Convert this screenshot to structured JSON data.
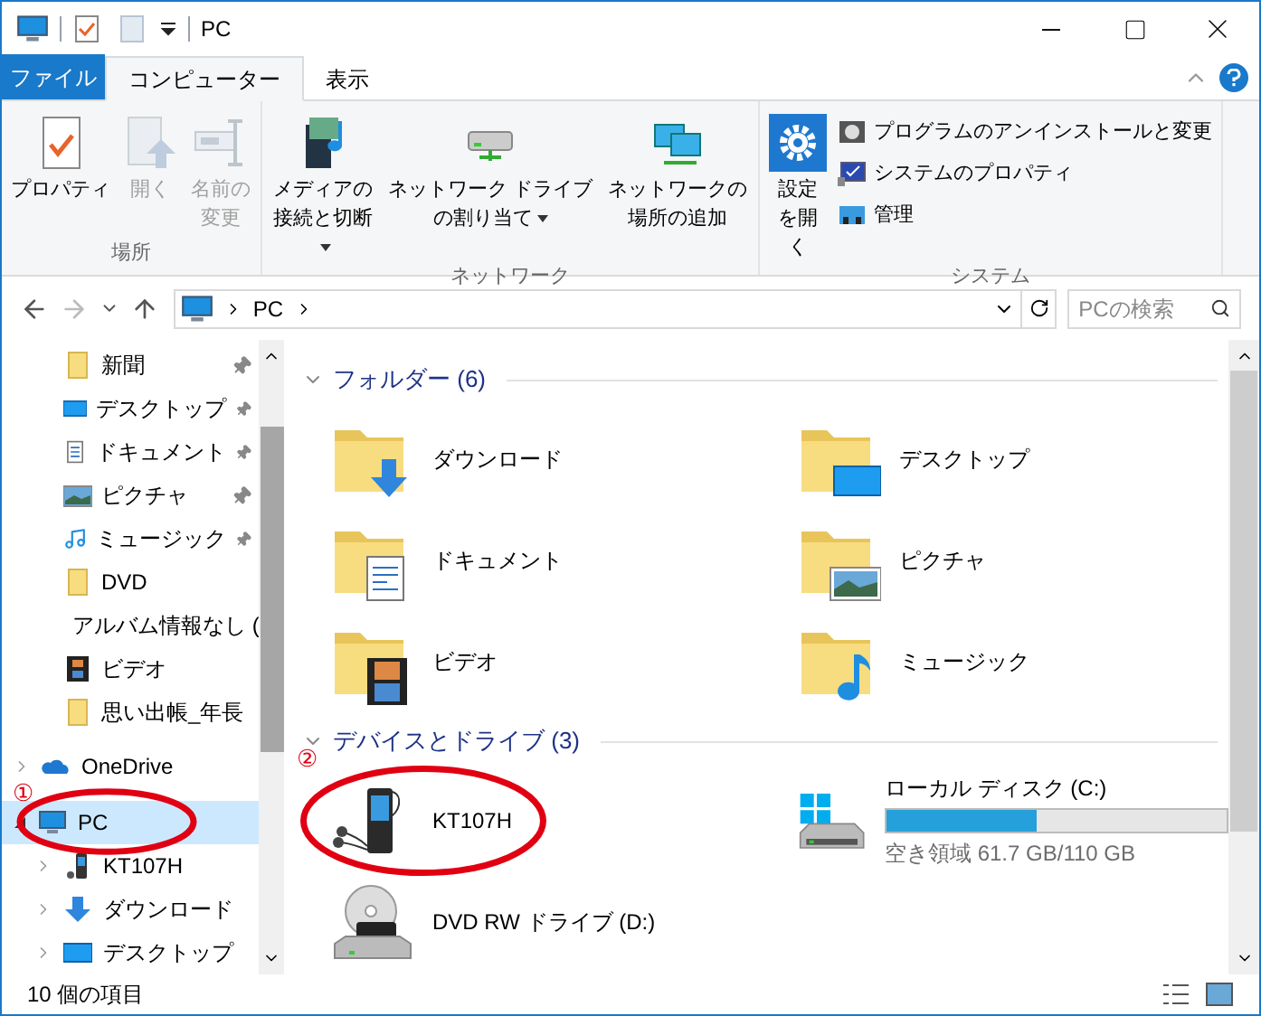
{
  "window": {
    "title": "PC"
  },
  "ribbon": {
    "tabs": [
      {
        "label": "ファイル",
        "kind": "file",
        "selected": false
      },
      {
        "label": "コンピューター",
        "kind": "tab",
        "selected": true
      },
      {
        "label": "表示",
        "kind": "tab",
        "selected": false
      }
    ],
    "groups": [
      {
        "label": "場所",
        "items": [
          {
            "kind": "properties",
            "label": "プロパティ",
            "disabled": false,
            "dropdown": false
          },
          {
            "kind": "open",
            "label": "開く",
            "disabled": true,
            "dropdown": false
          },
          {
            "kind": "rename",
            "label": "名前の変更",
            "disabled": true,
            "dropdown": false
          }
        ]
      },
      {
        "label": "ネットワーク",
        "items": [
          {
            "kind": "media",
            "label": "メディアの接続と切断",
            "disabled": false,
            "dropdown": true
          },
          {
            "kind": "map-drive",
            "label": "ネットワーク ドライブの割り当て",
            "disabled": false,
            "dropdown": true
          },
          {
            "kind": "add-location",
            "label": "ネットワークの場所の追加",
            "disabled": false,
            "dropdown": false
          }
        ]
      },
      {
        "label": "システム",
        "items": [
          {
            "kind": "settings",
            "label": "設定を開く",
            "disabled": false,
            "dropdown": false
          }
        ],
        "small_items": [
          {
            "kind": "uninstall",
            "label": "プログラムのアンインストールと変更"
          },
          {
            "kind": "system-properties",
            "label": "システムのプロパティ"
          },
          {
            "kind": "manage",
            "label": "管理"
          }
        ]
      }
    ]
  },
  "address_bar": {
    "path": [
      "PC"
    ],
    "search": {
      "placeholder": "PCの検索"
    }
  },
  "navigation_pane": {
    "quick_access": [
      {
        "kind": "folder",
        "label": "新聞",
        "pinned": true
      },
      {
        "kind": "desktop",
        "label": "デスクトップ",
        "pinned": true
      },
      {
        "kind": "document",
        "label": "ドキュメント",
        "pinned": true
      },
      {
        "kind": "picture",
        "label": "ピクチャ",
        "pinned": true
      },
      {
        "kind": "music",
        "label": "ミュージック",
        "pinned": true
      },
      {
        "kind": "folder",
        "label": "DVD",
        "pinned": false
      },
      {
        "kind": "folder",
        "label": "アルバム情報なし (",
        "pinned": false
      },
      {
        "kind": "video",
        "label": "ビデオ",
        "pinned": false
      },
      {
        "kind": "folder",
        "label": "思い出帳_年長",
        "pinned": false
      }
    ],
    "tree": [
      {
        "kind": "onedrive",
        "label": "OneDrive",
        "selected": false,
        "expanded": false
      },
      {
        "kind": "pc",
        "label": "PC",
        "selected": true,
        "expanded": true,
        "annotation": {
          "label": "①"
        },
        "children": [
          {
            "kind": "player",
            "label": "KT107H",
            "selected": false,
            "expanded": false
          },
          {
            "kind": "download",
            "label": "ダウンロード",
            "selected": false,
            "expanded": false
          },
          {
            "kind": "desktop",
            "label": "デスクトップ",
            "selected": false,
            "expanded": false
          }
        ]
      }
    ]
  },
  "content": {
    "sections": [
      {
        "title": "フォルダー (6)",
        "expanded": true,
        "items": [
          {
            "kind": "download",
            "label": "ダウンロード"
          },
          {
            "kind": "desktop",
            "label": "デスクトップ"
          },
          {
            "kind": "document",
            "label": "ドキュメント"
          },
          {
            "kind": "picture",
            "label": "ピクチャ"
          },
          {
            "kind": "video",
            "label": "ビデオ"
          },
          {
            "kind": "music",
            "label": "ミュージック"
          }
        ]
      },
      {
        "title": "デバイスとドライブ (3)",
        "expanded": true,
        "items": [
          {
            "kind": "player",
            "label": "KT107H",
            "annotation": {
              "label": "②"
            }
          },
          {
            "kind": "disk",
            "label": "ローカル ディスク (C:)",
            "level": 0.44,
            "info": "空き領域 61.7 GB/110 GB"
          },
          {
            "kind": "dvd",
            "label": "DVD RW ドライブ (D:)"
          }
        ]
      }
    ]
  },
  "status_bar": {
    "text": "10 個の項目"
  }
}
